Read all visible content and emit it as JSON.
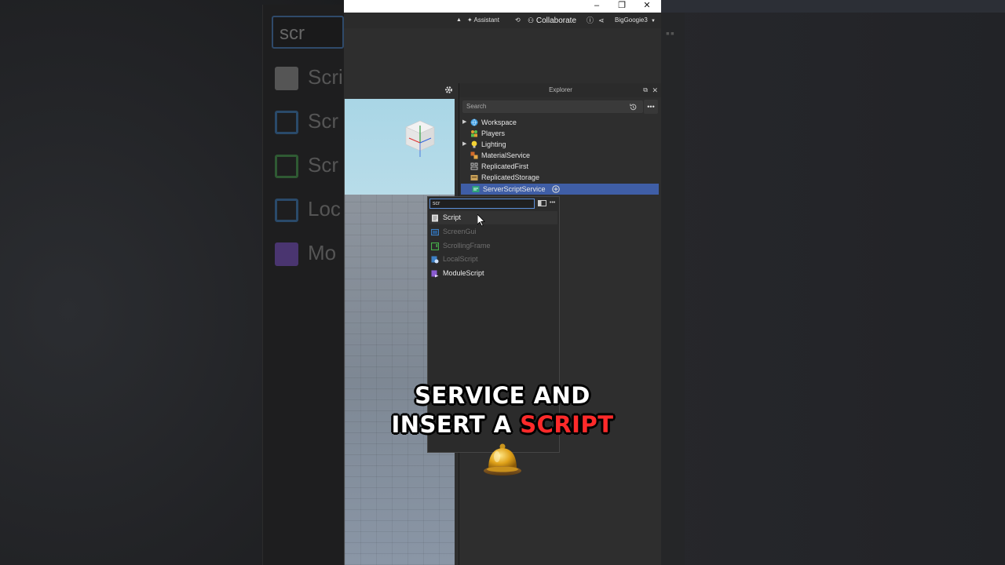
{
  "background": {
    "zoomed_search_text": "scr",
    "zoomed_items": [
      "Scri",
      "Scr",
      "Scr",
      "Loc",
      "Mo"
    ]
  },
  "titlebar": {
    "minimize": "–",
    "restore": "❐",
    "close": "✕"
  },
  "ribbon": {
    "assistant": "Assistant",
    "collaborate": "Collaborate",
    "username": "BigGoogie3"
  },
  "explorer": {
    "title": "Explorer",
    "search_placeholder": "Search",
    "items": [
      {
        "label": "Workspace",
        "expandable": true,
        "icon": "globe-icon",
        "selected": false
      },
      {
        "label": "Players",
        "expandable": false,
        "icon": "players-icon",
        "selected": false
      },
      {
        "label": "Lighting",
        "expandable": true,
        "icon": "lightbulb-icon",
        "selected": false
      },
      {
        "label": "MaterialService",
        "expandable": false,
        "icon": "material-icon",
        "selected": false
      },
      {
        "label": "ReplicatedFirst",
        "expandable": false,
        "icon": "replicated-first-icon",
        "selected": false
      },
      {
        "label": "ReplicatedStorage",
        "expandable": false,
        "icon": "storage-icon",
        "selected": false
      },
      {
        "label": "ServerScriptService",
        "expandable": false,
        "icon": "server-script-service-icon",
        "selected": true
      }
    ]
  },
  "insert_popup": {
    "query": "scr",
    "items": [
      {
        "label": "Script",
        "enabled": true,
        "icon": "script-icon",
        "color": "#d8d8d8"
      },
      {
        "label": "ScreenGui",
        "enabled": false,
        "icon": "screengui-icon",
        "color": "#3d7fc4"
      },
      {
        "label": "ScrollingFrame",
        "enabled": false,
        "icon": "scrollingframe-icon",
        "color": "#46b04a"
      },
      {
        "label": "LocalScript",
        "enabled": false,
        "icon": "localscript-icon",
        "color": "#3d7fc4"
      },
      {
        "label": "ModuleScript",
        "enabled": true,
        "icon": "modulescript-icon",
        "color": "#8a5bd0"
      }
    ]
  },
  "caption": {
    "line1": "SERVICE AND",
    "line2_white": "INSERT A",
    "line2_red": "SCRIPT"
  },
  "colors": {
    "selection": "#3f5ea6",
    "caption_red": "#ff2a2a",
    "focus_border": "#5b8ed8"
  }
}
